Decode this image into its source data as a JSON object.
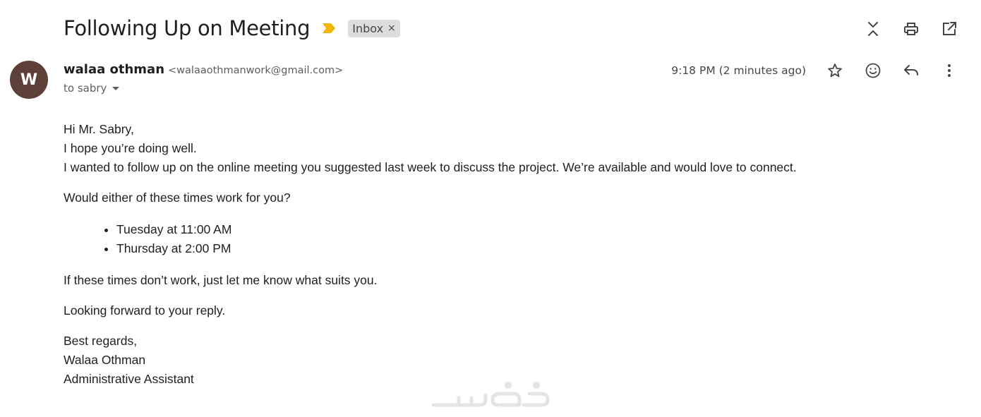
{
  "header": {
    "subject": "Following Up on Meeting",
    "label": "Inbox",
    "label_remove": "×",
    "importance_color": "#f4b400"
  },
  "top_actions": {
    "icons": [
      "collapse-all-icon",
      "print-icon",
      "open-in-new-window-icon"
    ]
  },
  "message": {
    "avatar_letter": "W",
    "avatar_color": "#5d4037",
    "sender_name": "walaa othman",
    "sender_email": "<walaaothmanwork@gmail.com>",
    "recipient": "to sabry",
    "timestamp": "9:18 PM (2 minutes ago)",
    "actions": [
      "star-icon",
      "emoji-reaction-icon",
      "reply-icon",
      "more-options-icon"
    ]
  },
  "body": {
    "greeting": "Hi Mr. Sabry,",
    "line1": "I hope you’re doing well.",
    "line2": "I wanted to follow up on the online meeting you suggested last week to discuss the project. We’re available and would love to connect.",
    "question": "Would either of these times work for you?",
    "options": [
      "Tuesday at 11:00 AM",
      "Thursday at 2:00 PM"
    ],
    "fallback": "If these times don’t work, just let me know what suits you.",
    "closing": "Looking forward to your reply.",
    "signoff": "Best regards,",
    "sig_name": "Walaa Othman",
    "sig_title": "Administrative Assistant"
  }
}
